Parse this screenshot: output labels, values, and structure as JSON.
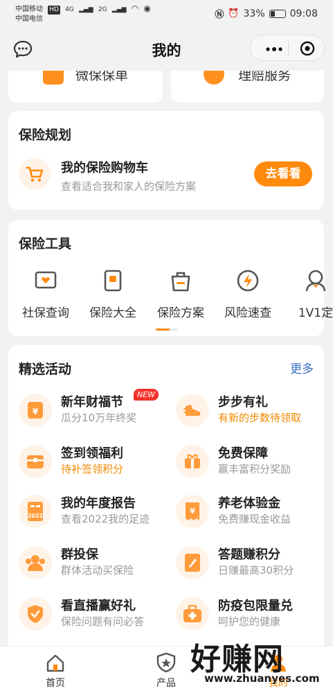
{
  "status_bar": {
    "carrier1": "中国移动",
    "carrier2": "中国电信",
    "hd": "HD",
    "net1": "4G",
    "net2": "2G",
    "battery": "33%",
    "time": "09:08",
    "battery_level": 0.33
  },
  "header": {
    "title": "我的"
  },
  "top_cards": {
    "left_label": "微保保单",
    "right_label": "理赔服务"
  },
  "planning": {
    "title": "保险规划",
    "item_name": "我的保险购物车",
    "item_desc": "查看适合我和家人的保险方案",
    "button": "去看看"
  },
  "tools": {
    "title": "保险工具",
    "items": [
      {
        "label": "社保查询",
        "icon": "tv-heart-icon"
      },
      {
        "label": "保险大全",
        "icon": "book-icon"
      },
      {
        "label": "保险方案",
        "icon": "bag-icon"
      },
      {
        "label": "风险速查",
        "icon": "lightning-icon"
      },
      {
        "label": "1V1定",
        "icon": "person-icon"
      }
    ]
  },
  "activities": {
    "title": "精选活动",
    "more": "更多",
    "new_badge": "NEW",
    "items": [
      {
        "name": "新年财福节",
        "desc": "瓜分10万年终奖",
        "highlight": false
      },
      {
        "name": "步步有礼",
        "desc": "有新的步数待领取",
        "highlight": true
      },
      {
        "name": "签到领福利",
        "desc": "待补签领积分",
        "highlight": true
      },
      {
        "name": "免费保障",
        "desc": "赢丰富积分奖励",
        "highlight": false
      },
      {
        "name": "我的年度报告",
        "desc": "查看2022我的足迹",
        "highlight": false
      },
      {
        "name": "养老体验金",
        "desc": "免费赚现金收益",
        "highlight": false
      },
      {
        "name": "群投保",
        "desc": "群体活动买保险",
        "highlight": false
      },
      {
        "name": "答题赚积分",
        "desc": "日赚最高30积分",
        "highlight": false
      },
      {
        "name": "看直播赢好礼",
        "desc": "保险问题有问必答",
        "highlight": false
      },
      {
        "name": "防疫包限量兑",
        "desc": "呵护您的健康",
        "highlight": false
      }
    ],
    "icon_text_2022": "2022"
  },
  "bottom_nav": {
    "items": [
      {
        "label": "首页"
      },
      {
        "label": "产品"
      },
      {
        "label": "我的"
      }
    ]
  },
  "watermark": {
    "big": "好赚网",
    "small": "www.zhuanyes.com"
  },
  "colors": {
    "accent": "#ff8a0d",
    "link": "#3c6fc4",
    "badge": "#f4332a"
  }
}
